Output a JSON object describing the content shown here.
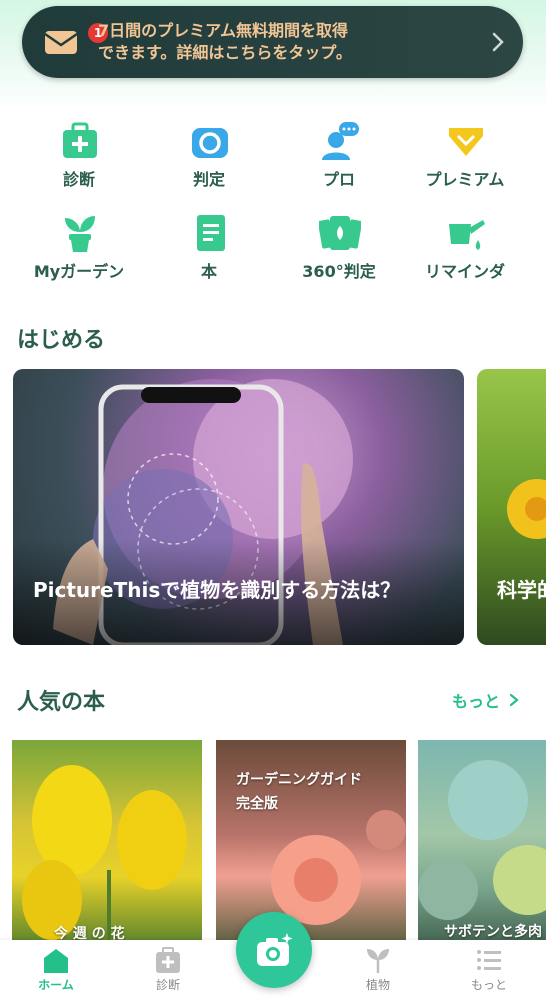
{
  "promo": {
    "badge": "1",
    "line1": "7日間のプレミアム無料期間を取得",
    "line2": "できます。詳細はこちらをタップ。"
  },
  "grid": [
    {
      "label": "診断",
      "icon": "medkit-icon"
    },
    {
      "label": "判定",
      "icon": "camera-icon"
    },
    {
      "label": "プロ",
      "icon": "expert-chat-icon"
    },
    {
      "label": "プレミアム",
      "icon": "diamond-icon"
    },
    {
      "label": "Myガーデン",
      "icon": "potted-plant-icon"
    },
    {
      "label": "本",
      "icon": "book-icon"
    },
    {
      "label": "360°判定",
      "icon": "panorama-cards-icon"
    },
    {
      "label": "リマインダ",
      "icon": "watering-can-icon"
    }
  ],
  "sections": {
    "start_title": "はじめる",
    "books_title": "人気の本",
    "more_label": "もっと"
  },
  "cards": {
    "main_title": "PictureThisで植物を識別する方法は？",
    "side_title": "科学的"
  },
  "books": [
    {
      "title": "今 週 の 花"
    },
    {
      "title_line1": "ガーデニングガイド",
      "title_line2": "完全版"
    },
    {
      "title": "サボテンと多肉"
    }
  ],
  "tabs": [
    {
      "label": "ホーム",
      "active": true
    },
    {
      "label": "診断"
    },
    {
      "label": "植物"
    },
    {
      "label": "もっと"
    }
  ],
  "colors": {
    "accent": "#23c08a",
    "label_green": "#2b5e4e",
    "promo_bg": "#1f3b3a",
    "promo_text": "#f2c594"
  }
}
